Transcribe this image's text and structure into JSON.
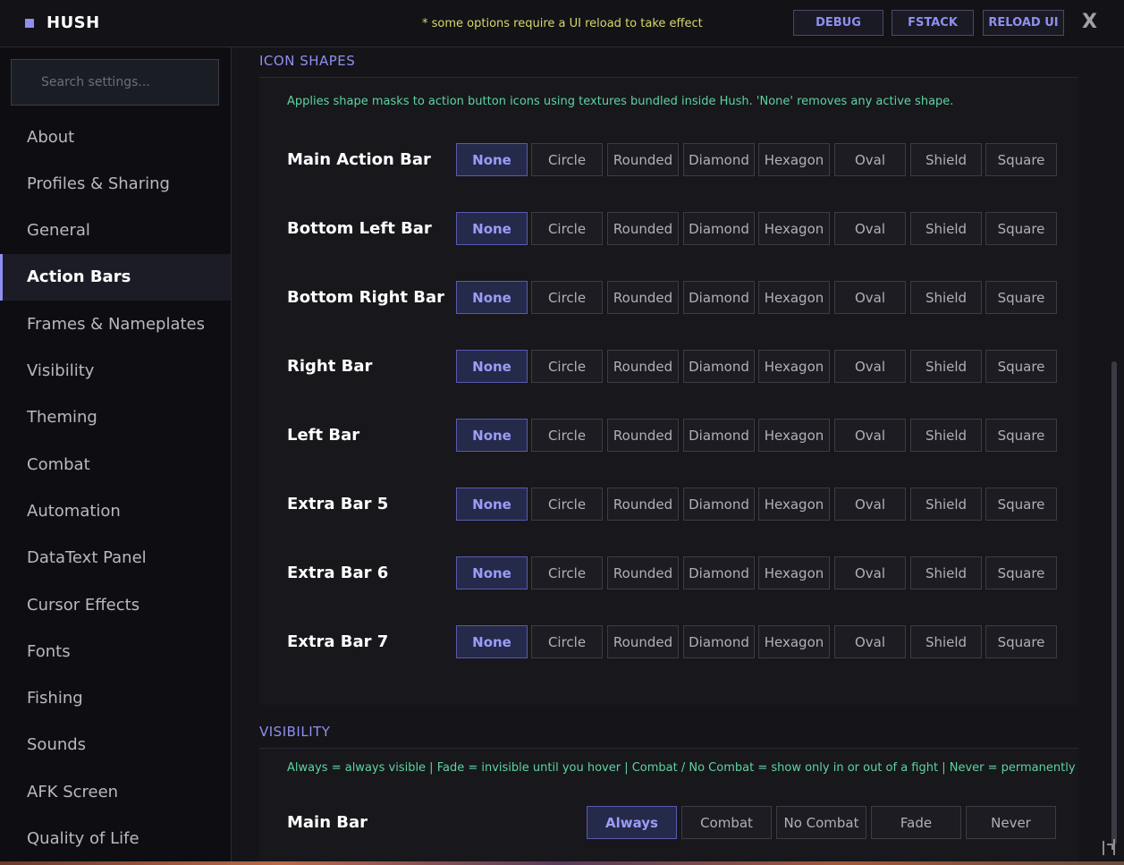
{
  "app": {
    "title": "HUSH",
    "reload_note": "* some options require a UI reload to take effect",
    "buttons": [
      "DEBUG",
      "FSTACK",
      "RELOAD UI"
    ],
    "close_label": "X"
  },
  "sidebar": {
    "search_placeholder": "Search settings...",
    "items": [
      {
        "label": "About"
      },
      {
        "label": "Profiles & Sharing"
      },
      {
        "label": "General"
      },
      {
        "label": "Action Bars",
        "active": true
      },
      {
        "label": "Frames & Nameplates"
      },
      {
        "label": "Visibility"
      },
      {
        "label": "Theming"
      },
      {
        "label": "Combat"
      },
      {
        "label": "Automation"
      },
      {
        "label": "DataText Panel"
      },
      {
        "label": "Cursor Effects"
      },
      {
        "label": "Fonts"
      },
      {
        "label": "Fishing"
      },
      {
        "label": "Sounds"
      },
      {
        "label": "AFK Screen"
      },
      {
        "label": "Quality of Life"
      }
    ]
  },
  "icon_shapes": {
    "title": "ICON SHAPES",
    "description": "Applies shape masks to action button icons using textures bundled inside Hush.  'None' removes any active shape.",
    "options": [
      "None",
      "Circle",
      "Rounded",
      "Diamond",
      "Hexagon",
      "Oval",
      "Shield",
      "Square"
    ],
    "rows": [
      {
        "label": "Main Action Bar",
        "selected": "None"
      },
      {
        "label": "Bottom Left Bar",
        "selected": "None"
      },
      {
        "label": "Bottom Right Bar",
        "selected": "None"
      },
      {
        "label": "Right Bar",
        "selected": "None"
      },
      {
        "label": "Left Bar",
        "selected": "None"
      },
      {
        "label": "Extra Bar 5",
        "selected": "None"
      },
      {
        "label": "Extra Bar 6",
        "selected": "None"
      },
      {
        "label": "Extra Bar 7",
        "selected": "None"
      }
    ]
  },
  "visibility": {
    "title": "VISIBILITY",
    "description": "Always = always visible  |  Fade = invisible until you hover  |  Combat / No Combat = show only in or out of a fight  |  Never = permanently",
    "options": [
      "Always",
      "Combat",
      "No Combat",
      "Fade",
      "Never"
    ],
    "rows": [
      {
        "label": "Main Bar",
        "selected": "Always"
      }
    ]
  },
  "colors": {
    "accent": "#8f8ff0",
    "description_text": "#5fd3a0",
    "reload_note": "#d8d86a"
  }
}
